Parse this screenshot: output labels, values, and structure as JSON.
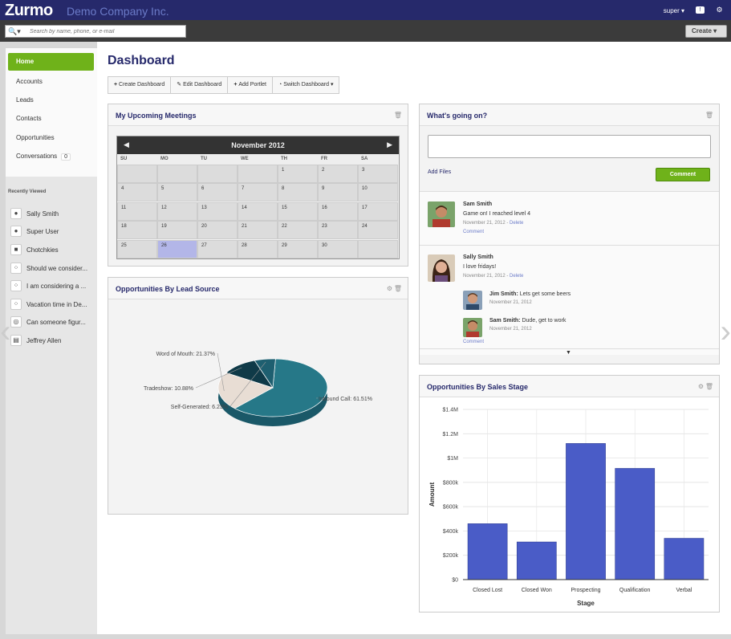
{
  "header": {
    "logo": "Zurmo",
    "company": "Demo Company Inc.",
    "user": "super ▾",
    "notifications_icon": "chat-bubble-icon",
    "settings_icon": "gear-icon"
  },
  "search": {
    "placeholder": "Search by name, phone, or e-mail",
    "create_label": "Create ▾"
  },
  "nav": {
    "items": [
      {
        "label": "Home"
      },
      {
        "label": "Accounts"
      },
      {
        "label": "Leads"
      },
      {
        "label": "Contacts"
      },
      {
        "label": "Opportunities"
      },
      {
        "label": "Conversations",
        "badge": "0"
      }
    ]
  },
  "recently_viewed": {
    "title": "Recently Viewed",
    "items": [
      {
        "label": "Sally Smith",
        "icon": "person-icon"
      },
      {
        "label": "Super User",
        "icon": "person-icon"
      },
      {
        "label": "Chotchkies",
        "icon": "folder-icon"
      },
      {
        "label": "Should we consider...",
        "icon": "conversation-icon"
      },
      {
        "label": "I am considering a ...",
        "icon": "conversation-icon"
      },
      {
        "label": "Vacation time in De...",
        "icon": "conversation-icon"
      },
      {
        "label": "Can someone figur...",
        "icon": "globe-icon"
      },
      {
        "label": "Jeffrey Allen",
        "icon": "card-icon"
      }
    ]
  },
  "dashboard": {
    "title": "Dashboard",
    "toolbar": {
      "create": "Create Dashboard",
      "edit": "Edit Dashboard",
      "add": "Add Portlet",
      "switch": "Switch Dashboard"
    }
  },
  "meetings": {
    "title": "My Upcoming Meetings",
    "month": "November 2012",
    "dow": [
      "SU",
      "MO",
      "TU",
      "WE",
      "TH",
      "FR",
      "SA"
    ],
    "weeks": [
      [
        "",
        "",
        "",
        "",
        "1",
        "2",
        "3"
      ],
      [
        "4",
        "5",
        "6",
        "7",
        "8",
        "9",
        "10"
      ],
      [
        "11",
        "12",
        "13",
        "14",
        "15",
        "16",
        "17"
      ],
      [
        "18",
        "19",
        "20",
        "21",
        "22",
        "23",
        "24"
      ],
      [
        "25",
        "26",
        "27",
        "28",
        "29",
        "30",
        ""
      ]
    ],
    "today": "26"
  },
  "lead_source": {
    "title": "Opportunities By Lead Source",
    "chart_data": {
      "type": "pie",
      "labels": [
        "Inbound Call",
        "Word of Mouth",
        "Tradeshow",
        "Self-Generated"
      ],
      "values": [
        61.51,
        21.37,
        10.88,
        6.23
      ],
      "display": [
        "Inbound Call: 61.51%",
        "Word of Mouth: 21.37%",
        "Tradeshow: 10.88%",
        "Self-Generated: 6.23%"
      ],
      "colors": [
        "#267888",
        "#e8ddd4",
        "#0f3a48",
        "#1e5f70"
      ]
    }
  },
  "feed": {
    "title": "What's going on?",
    "add_files": "Add Files",
    "comment_label": "Comment",
    "posts": [
      {
        "name": "Sam Smith",
        "text": "Game on! I reached level 4",
        "date": "November 21, 2012 - ",
        "delete": "Delete",
        "comment": "Comment"
      },
      {
        "name": "Sally Smith",
        "text": "I love fridays!",
        "date": "November 21, 2012 - ",
        "delete": "Delete",
        "comment": "Comment"
      }
    ],
    "replies": [
      {
        "name": "Jim Smith:",
        "text": " Lets get some beers",
        "date": "November 21, 2012"
      },
      {
        "name": "Sam Smith:",
        "text": " Dude, get to work",
        "date": "November 21, 2012"
      }
    ],
    "more_icon": "arrow-down-icon"
  },
  "sales_stage": {
    "title": "Opportunities By Sales Stage",
    "chart_data": {
      "type": "bar",
      "categories": [
        "Closed Lost",
        "Closed Won",
        "Prospecting",
        "Qualification",
        "Verbal"
      ],
      "values": [
        460000,
        310000,
        1120000,
        915000,
        340000
      ],
      "xlabel": "Stage",
      "ylabel": "Amount",
      "yticks": [
        "$0",
        "$200k",
        "$400k",
        "$600k",
        "$800k",
        "$1M",
        "$1.2M",
        "$1.4M"
      ],
      "ylim": [
        0,
        1400000
      ],
      "color": "#4a5cc7"
    }
  }
}
